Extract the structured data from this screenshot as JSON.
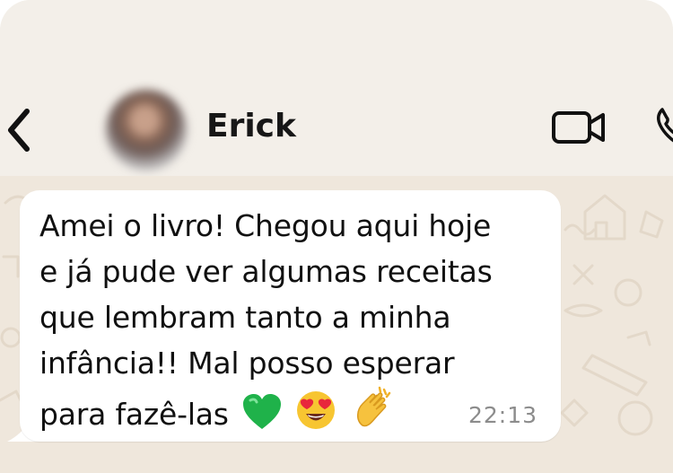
{
  "contact": {
    "name": "Erick"
  },
  "header": {
    "back_icon": "chevron-left-icon",
    "video_icon": "video-camera-icon",
    "call_icon": "phone-icon"
  },
  "message": {
    "lines": [
      "Amei o livro! Chegou aqui hoje",
      "e já pude ver algumas receitas",
      "que lembram tanto a minha",
      "infância!! Mal posso esperar",
      "para fazê-las"
    ],
    "emojis": [
      "green-heart-icon",
      "heart-eyes-icon",
      "clapping-hands-icon"
    ],
    "time": "22:13"
  },
  "colors": {
    "header_bg": "#f3efe9",
    "wallpaper_bg": "#efe7dc",
    "bubble_bg": "#ffffff",
    "text": "#111111",
    "time": "#8c8c8c"
  }
}
